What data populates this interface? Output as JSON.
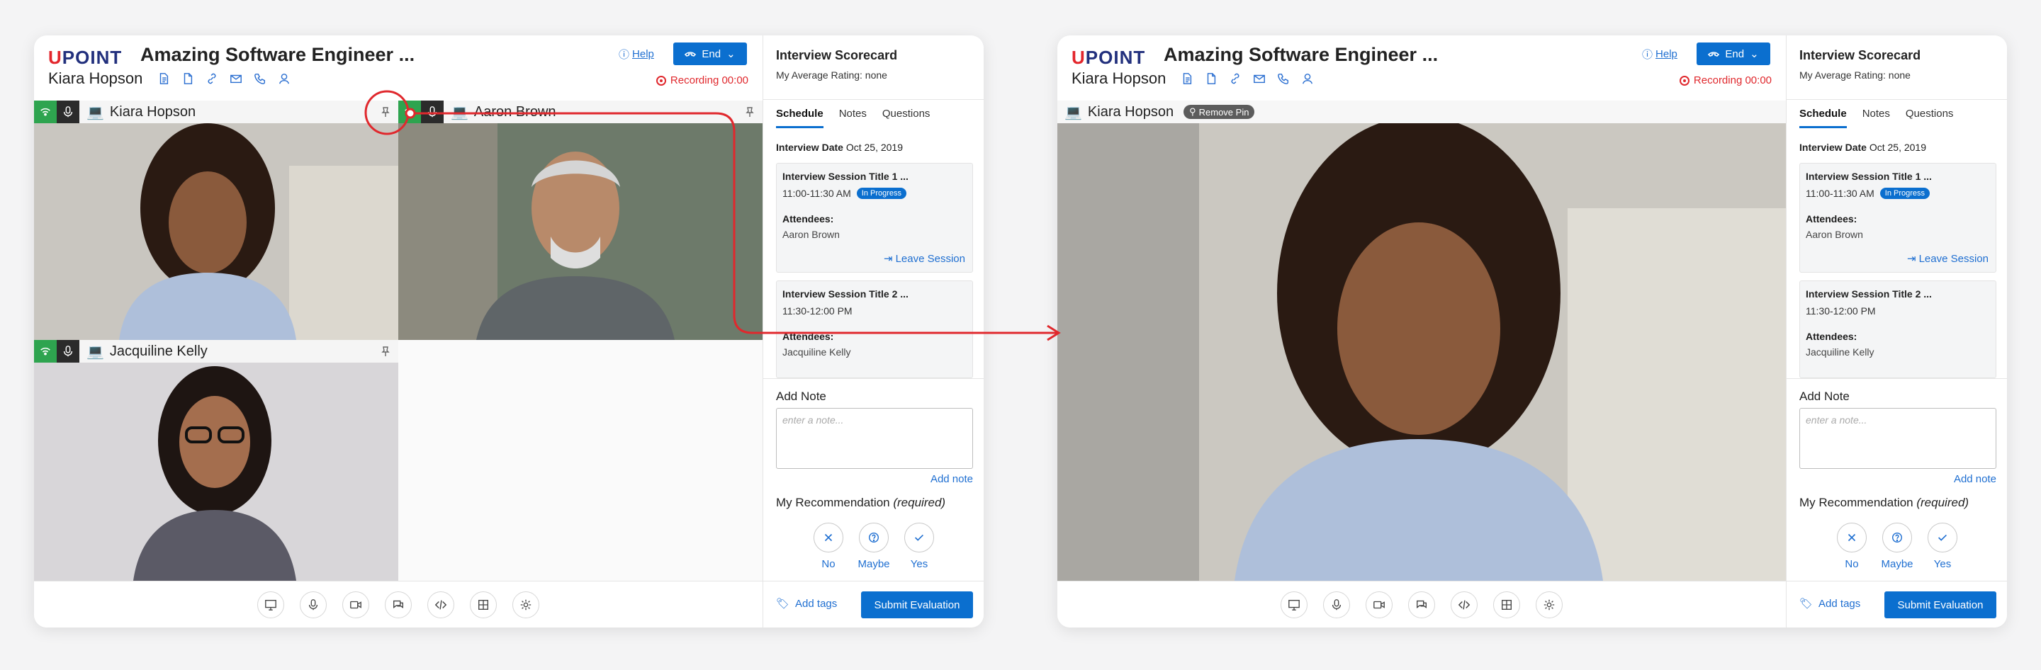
{
  "brand": {
    "logo_u": "U",
    "logo_rest": "POINT"
  },
  "header": {
    "title": "Amazing Software Engineer ...",
    "candidate": "Kiara Hopson",
    "help_label": "Help",
    "end_label": "End",
    "recording_label": "Recording 00:00"
  },
  "tiles": [
    {
      "name": "Kiara  Hopson"
    },
    {
      "name": "Aaron  Brown"
    },
    {
      "name": "Jacquiline  Kelly"
    }
  ],
  "pinned": {
    "name": "Kiara  Hopson",
    "remove_pin_label": "Remove Pin"
  },
  "panel": {
    "title": "Interview Scorecard",
    "avg_rating": "My Average Rating: none",
    "tabs": [
      "Schedule",
      "Notes",
      "Questions"
    ],
    "interview_date_label": "Interview Date",
    "interview_date": "Oct 25, 2019",
    "sessions": [
      {
        "title": "Interview Session Title 1 ...",
        "time": "11:00-11:30 AM",
        "status": "In Progress",
        "attendees_label": "Attendees:",
        "attendees": "Aaron Brown",
        "leave_label": "Leave Session"
      },
      {
        "title": "Interview Session Title 2 ...",
        "time": "11:30-12:00 PM",
        "attendees_label": "Attendees:",
        "attendees": "Jacquiline Kelly"
      }
    ],
    "add_note_label": "Add Note",
    "note_placeholder": "enter a note...",
    "add_note_button": "Add note",
    "recommendation_label": "My Recommendation",
    "recommendation_required": "(required)",
    "options": [
      "No",
      "Maybe",
      "Yes"
    ],
    "add_tags_label": "Add tags",
    "submit_label": "Submit Evaluation"
  },
  "colors": {
    "accent": "#0b6fcf",
    "record_red": "#e0282d",
    "signal_green": "#2ea44f",
    "highlight_orange": "#f29a45"
  }
}
